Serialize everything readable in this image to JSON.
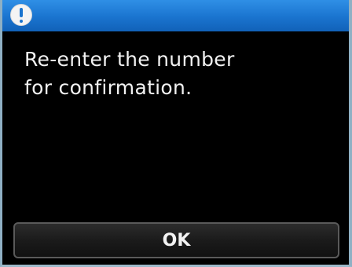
{
  "dialog": {
    "icon": "exclamation-icon",
    "message": "Re-enter the number\nfor confirmation.",
    "ok_label": "OK"
  },
  "colors": {
    "title_bar": "#1a74cf",
    "background": "#000000",
    "text": "#f2f2f2"
  }
}
